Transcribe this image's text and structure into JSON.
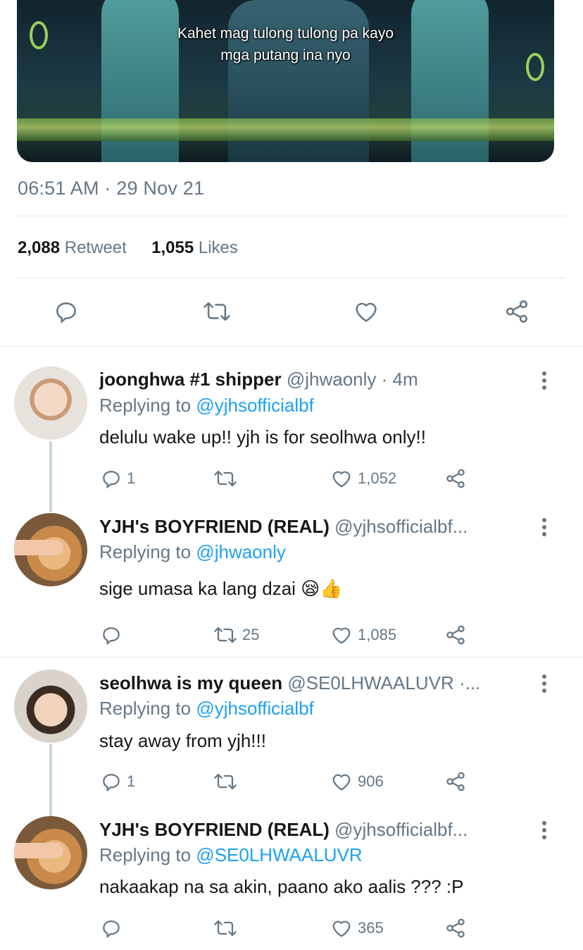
{
  "media": {
    "caption_line1": "Kahet mag tulong tulong pa kayo",
    "caption_line2": "mga putang ina nyo"
  },
  "tweet": {
    "timestamp": "06:51 AM · 29 Nov 21",
    "retweet_count": "2,088",
    "retweet_label": "Retweet",
    "like_count": "1,055",
    "like_label": "Likes"
  },
  "replies": [
    {
      "name": "joonghwa #1 shipper",
      "handle": "@jhwaonly · 4m",
      "replying_prefix": "Replying to",
      "replying_to": "@yjhsofficialbf",
      "text": "delulu wake up!! yjh is for seolhwa only!!",
      "reply_count": "1",
      "retweet_count": "",
      "like_count": "1,052"
    },
    {
      "name": "YJH's BOYFRIEND (REAL)",
      "handle": "@yjhsofficialbf...",
      "replying_prefix": "Replying to",
      "replying_to": "@jhwaonly",
      "text": "sige umasa ka lang dzai 😪👍",
      "reply_count": "",
      "retweet_count": "25",
      "like_count": "1,085"
    },
    {
      "name": "seolhwa is my queen",
      "handle": "@SE0LHWAALUVR ·...",
      "replying_prefix": "Replying to",
      "replying_to": "@yjhsofficialbf",
      "text": "stay away from yjh!!!",
      "reply_count": "1",
      "retweet_count": "",
      "like_count": "906"
    },
    {
      "name": "YJH's BOYFRIEND (REAL)",
      "handle": "@yjhsofficialbf...",
      "replying_prefix": "Replying to",
      "replying_to": "@SE0LHWAALUVR",
      "text": "nakaakap na sa akin, paano ako aalis ??? :P",
      "reply_count": "",
      "retweet_count": "",
      "like_count": "365"
    }
  ],
  "icons": {
    "reply": "reply-icon",
    "retweet": "retweet-icon",
    "like": "heart-icon",
    "share": "share-icon",
    "more": "more-vertical-icon"
  },
  "colors": {
    "text": "#14171a",
    "muted": "#657786",
    "link": "#1da1f2",
    "divider": "#e1e8ed"
  }
}
